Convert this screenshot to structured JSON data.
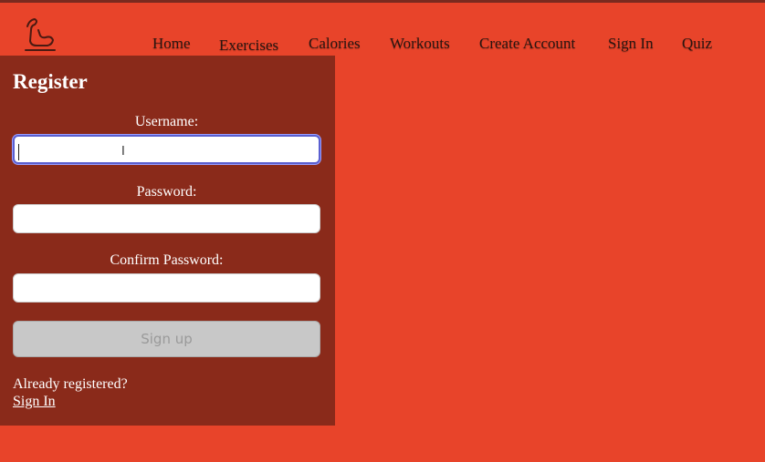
{
  "nav": {
    "items": [
      {
        "label": "Home"
      },
      {
        "label": "Exercises"
      },
      {
        "label": "Calories"
      },
      {
        "label": "Workouts"
      },
      {
        "label": "Create Account"
      },
      {
        "label": "Sign In"
      },
      {
        "label": "Quiz"
      }
    ]
  },
  "logo": {
    "icon": "flexed-arm-icon"
  },
  "form": {
    "title": "Register",
    "username_label": "Username:",
    "username_value": "",
    "password_label": "Password:",
    "password_value": "",
    "confirm_label": "Confirm Password:",
    "confirm_value": "",
    "submit_label": "Sign up",
    "already_text": "Already registered?",
    "signin_link": "Sign In"
  },
  "colors": {
    "page_bg": "#e8442a",
    "panel_bg": "#8a2a1a",
    "button_disabled": "#c8c8c8",
    "focus_ring": "#5a5fd0"
  }
}
